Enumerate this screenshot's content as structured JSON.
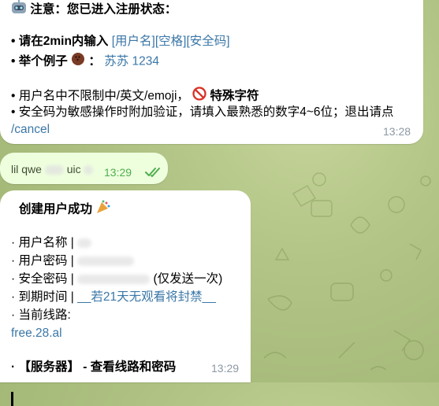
{
  "chat": {
    "message1": {
      "title": "注意：您已进入注册状态：",
      "line_input_prefix": "• 请在2min内输入",
      "line_input_placeholder": "[用户名][空格][安全码]",
      "line_example_prefix": "• 举个例子",
      "line_example_value": "苏苏 1234",
      "line_username_rule": "• 用户名中不限制中/英文/emoji，",
      "line_username_rule_bold": "特殊字符",
      "line_security_rule": "• 安全码为敏感操作时附加验证，请填入最熟悉的数字4~6位；退出请点",
      "cancel_command": "/cancel",
      "time": "13:28"
    },
    "message2": {
      "text_partial": "lil qwe",
      "text_partial_2": "uic",
      "time": "13:29"
    },
    "message3": {
      "title": "创建用户成功",
      "username_label": "· 用户名称 |",
      "password_label": "· 用户密码 |",
      "security_label": "· 安全密码 |",
      "security_note": "(仅发送一次)",
      "expire_label": "· 到期时间 |",
      "expire_value": "__若21天无观看将封禁__",
      "route_label": "· 当前线路:",
      "route_value": "free.28.al",
      "server_line": "· 【服务器】 - 查看线路和密码",
      "time": "13:29"
    }
  },
  "icons": {
    "robot": "robot-icon",
    "coconut": "coconut-icon",
    "prohibited": "prohibited-icon",
    "party": "party-popper-icon",
    "double_check": "double-check-icon"
  },
  "colors": {
    "link": "#3b77a7",
    "time": "#8c98a4",
    "outgoing_bubble": "#eeffde",
    "read_check": "#4fae4e"
  }
}
